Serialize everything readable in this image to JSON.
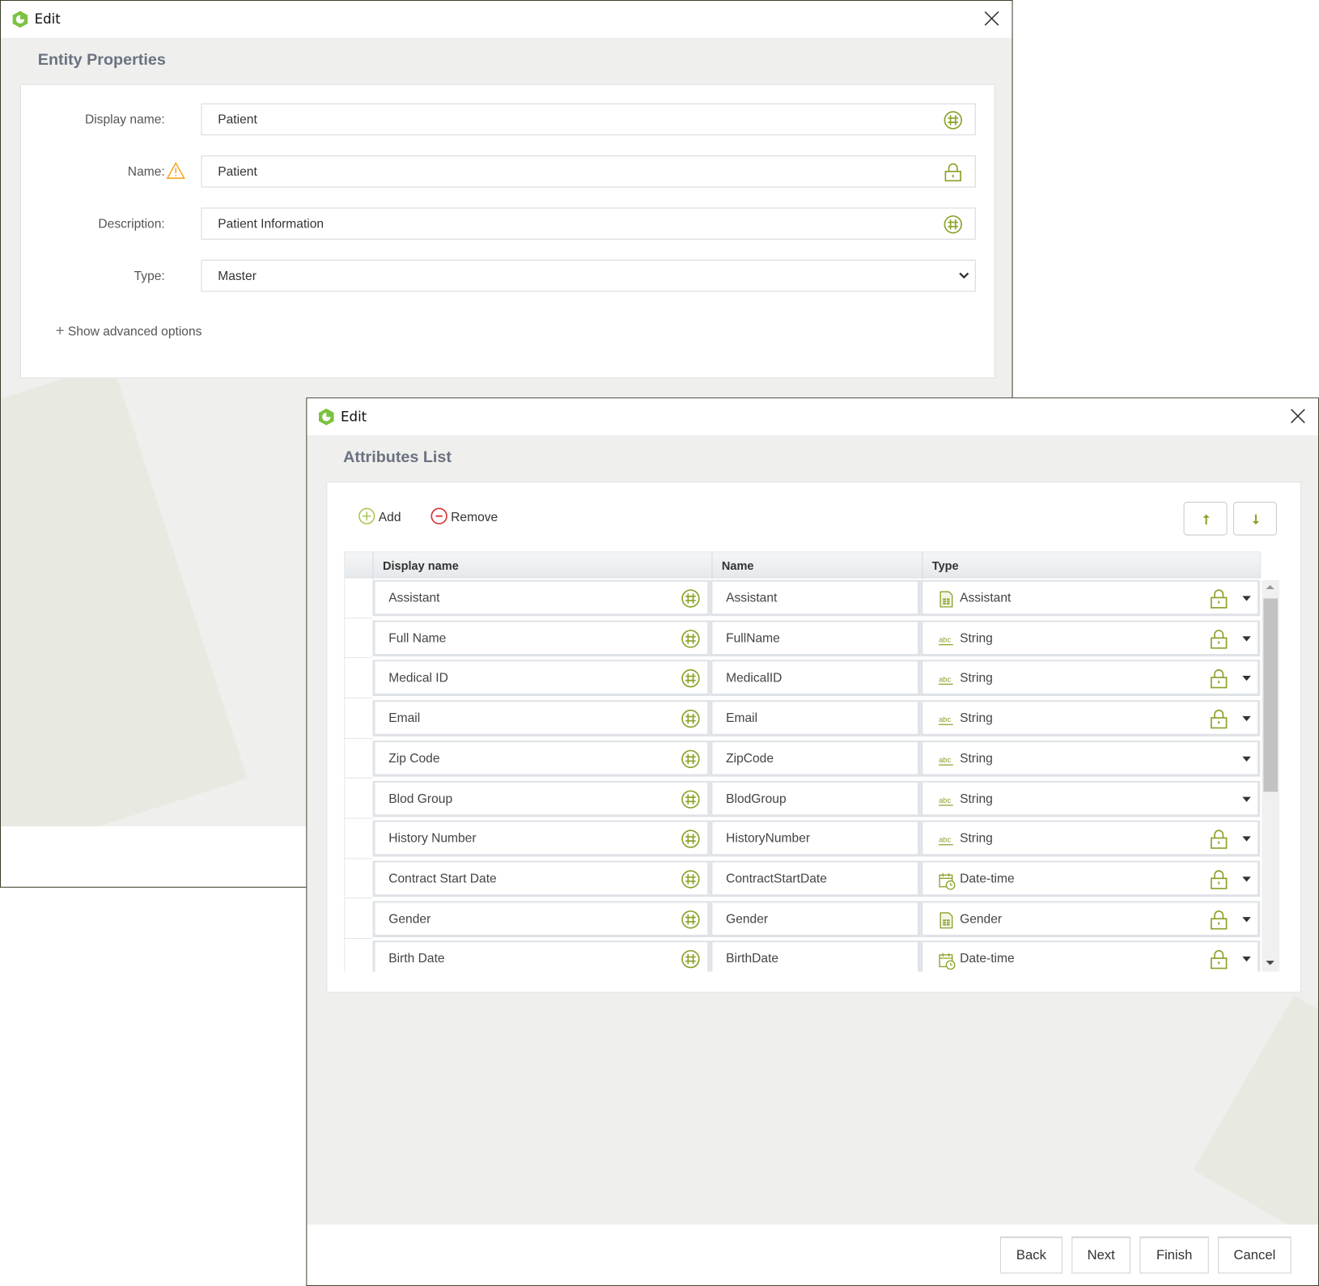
{
  "back_window": {
    "title": "Edit",
    "section_title": "Entity Properties",
    "fields": {
      "display_name": {
        "label": "Display name:",
        "value": "Patient",
        "icon": "globe-translate-icon"
      },
      "name": {
        "label": "Name:",
        "value": "Patient",
        "icon": "lock-icon",
        "warning_icon": "warning-icon"
      },
      "description": {
        "label": "Description:",
        "value": "Patient Information",
        "icon": "globe-translate-icon"
      },
      "type": {
        "label": "Type:",
        "value": "Master",
        "icon": "chevron-down-icon"
      }
    },
    "advanced_link": "Show advanced options"
  },
  "front_window": {
    "title": "Edit",
    "section_title": "Attributes List",
    "toolbar": {
      "add_label": "Add",
      "remove_label": "Remove",
      "move_up_icon": "arrow-up-icon",
      "move_down_icon": "arrow-down-icon"
    },
    "grid": {
      "columns": [
        "Display name",
        "Name",
        "Type"
      ],
      "rows": [
        {
          "display_name": "Assistant",
          "name": "Assistant",
          "type": "Assistant",
          "type_icon": "entity-icon",
          "locked": true
        },
        {
          "display_name": "Full Name",
          "name": "FullName",
          "type": "String",
          "type_icon": "string-icon",
          "locked": true
        },
        {
          "display_name": "Medical ID",
          "name": "MedicalID",
          "type": "String",
          "type_icon": "string-icon",
          "locked": true
        },
        {
          "display_name": "Email",
          "name": "Email",
          "type": "String",
          "type_icon": "string-icon",
          "locked": true
        },
        {
          "display_name": "Zip Code",
          "name": "ZipCode",
          "type": "String",
          "type_icon": "string-icon",
          "locked": false
        },
        {
          "display_name": "Blod Group",
          "name": "BlodGroup",
          "type": "String",
          "type_icon": "string-icon",
          "locked": false
        },
        {
          "display_name": "History Number",
          "name": "HistoryNumber",
          "type": "String",
          "type_icon": "string-icon",
          "locked": true
        },
        {
          "display_name": "Contract Start Date",
          "name": "ContractStartDate",
          "type": "Date-time",
          "type_icon": "datetime-icon",
          "locked": true
        },
        {
          "display_name": "Gender",
          "name": "Gender",
          "type": "Gender",
          "type_icon": "entity-icon",
          "locked": true
        },
        {
          "display_name": "Birth Date",
          "name": "BirthDate",
          "type": "Date-time",
          "type_icon": "datetime-icon",
          "locked": true
        }
      ]
    },
    "footer": {
      "back_label": "Back",
      "next_label": "Next",
      "finish_label": "Finish",
      "cancel_label": "Cancel"
    }
  },
  "colors": {
    "accent_green": "#8aa32a",
    "logo_green": "#7cc242",
    "remove_red": "#d9343a",
    "warning_orange": "#f5a623",
    "section_title": "#6a7280"
  }
}
